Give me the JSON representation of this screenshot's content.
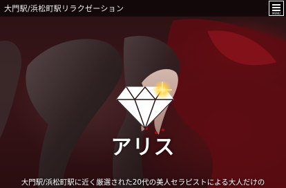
{
  "header": {
    "site_title": "大門駅/浜松町駅リラクゼーション",
    "menu_label": "MENU"
  },
  "hero": {
    "brand_name": "アリス",
    "tagline": "大門駅/浜松町駅に近く厳選された20代の美人セラピストによる大人だけの",
    "logo_icon": "diamond-icon"
  },
  "colors": {
    "accent_red": "#8c1018",
    "header_bg": "#000000",
    "text": "#ffffff",
    "sparkle": "#ffd23c"
  }
}
